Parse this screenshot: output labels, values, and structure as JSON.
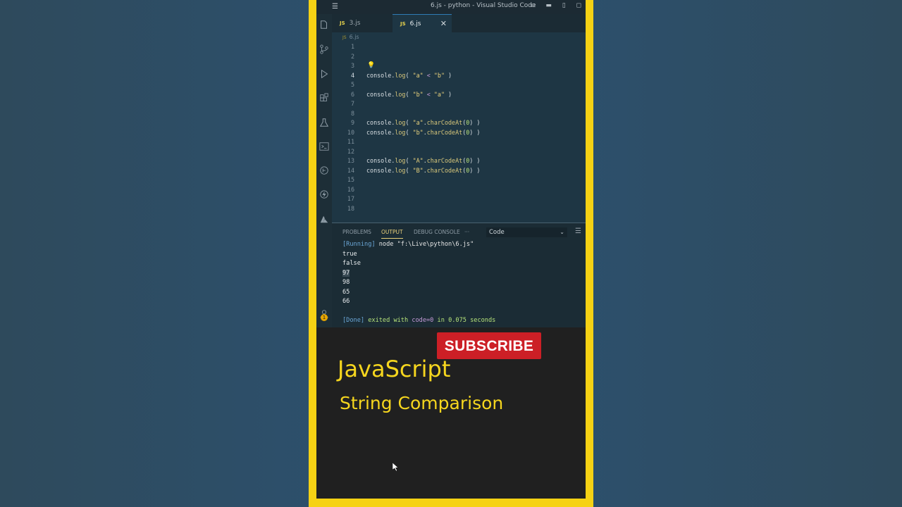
{
  "window": {
    "title": "6.js - python - Visual Studio Code",
    "menu_glyph": "☰",
    "buttons": "▫ ▬ ▯ ◻"
  },
  "tabs": [
    {
      "lang": "JS",
      "label": "3.js"
    },
    {
      "lang": "JS",
      "label": "6.js",
      "close": "✕"
    }
  ],
  "breadcrumb": {
    "lang": "JS",
    "label": "6.js"
  },
  "editor": {
    "lines": [
      {
        "n": "1"
      },
      {
        "n": "2"
      },
      {
        "n": "3"
      },
      {
        "n": "4"
      },
      {
        "n": "5"
      },
      {
        "n": "6"
      },
      {
        "n": "7"
      },
      {
        "n": "8"
      },
      {
        "n": "9"
      },
      {
        "n": "10"
      },
      {
        "n": "11"
      },
      {
        "n": "12"
      },
      {
        "n": "13"
      },
      {
        "n": "14"
      },
      {
        "n": "15"
      },
      {
        "n": "16"
      },
      {
        "n": "17"
      },
      {
        "n": "18"
      }
    ],
    "code": {
      "l4": [
        "console",
        ".",
        "log",
        "( ",
        "\"a\"",
        " < ",
        "\"b\"",
        " )"
      ],
      "l6": [
        "console",
        ".",
        "log",
        "( ",
        "\"b\"",
        " < ",
        "\"a\"",
        " )"
      ],
      "l9": [
        "console",
        ".",
        "log",
        "( ",
        "\"a\"",
        ".",
        "charCodeAt",
        "(",
        "0",
        ") )"
      ],
      "l10": [
        "console",
        ".",
        "log",
        "( ",
        "\"b\"",
        ".",
        "charCodeAt",
        "(",
        "0",
        ") )"
      ],
      "l13": [
        "console",
        ".",
        "log",
        "( ",
        "\"A\"",
        ".",
        "charCodeAt",
        "(",
        "0",
        ") )"
      ],
      "l14": [
        "console",
        ".",
        "log",
        "( ",
        "\"B\"",
        ".",
        "charCodeAt",
        "(",
        "0",
        ") )"
      ]
    }
  },
  "panel": {
    "tabs": [
      "PROBLEMS",
      "OUTPUT",
      "DEBUG CONSOLE",
      "···"
    ],
    "active_tab": "OUTPUT",
    "channel": "Code",
    "output": {
      "running": "[Running]",
      "command": " node \"f:\\Live\\python\\6.js\"",
      "results": [
        "true",
        "false",
        "97",
        "98",
        "65",
        "66"
      ],
      "done_prefix": "[Done]",
      "done_mid": " exited with ",
      "done_code": "code=0",
      "done_in": " in ",
      "done_time": "0.075",
      "done_suffix": " seconds"
    }
  },
  "overlay": {
    "subscribe": "SUBSCRIBE",
    "title": "JavaScript",
    "subtitle": "String Comparison"
  },
  "activity_badge": "1",
  "colors": {
    "frame": "#f6d214",
    "subscribe": "#cc1f26",
    "accent_text": "#f6d61e"
  }
}
